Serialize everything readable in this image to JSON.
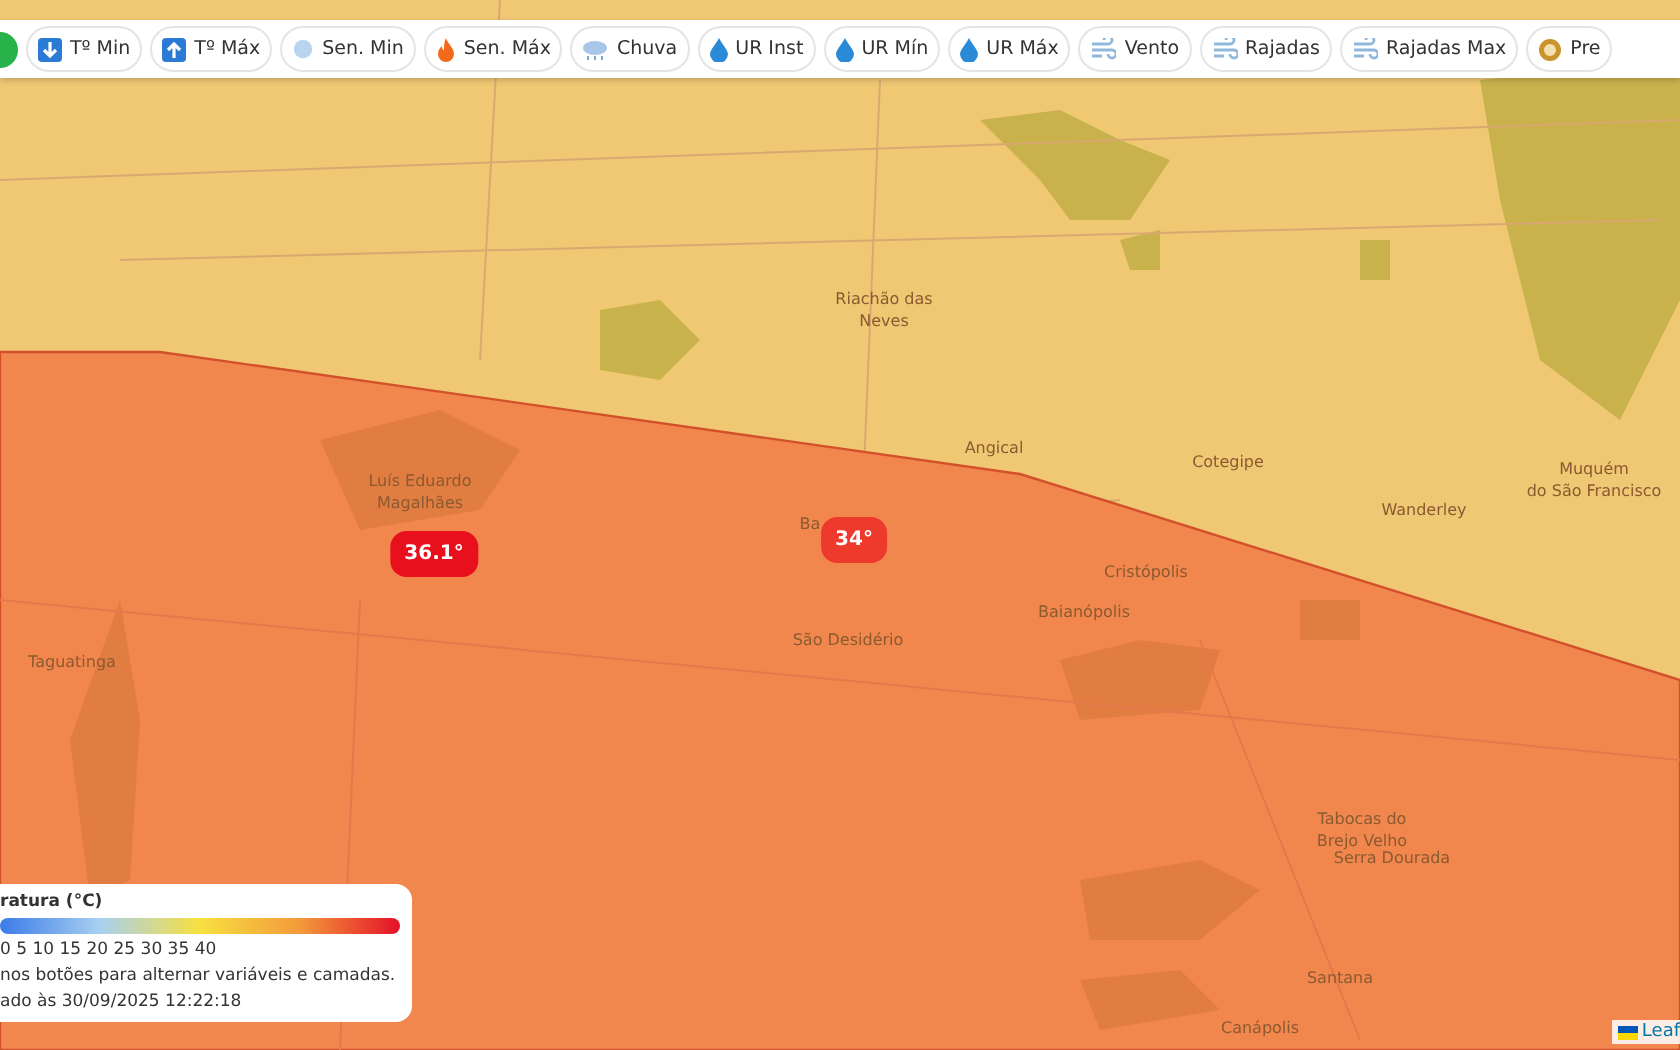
{
  "toolbar": {
    "buttons": [
      {
        "label": "Tº Min"
      },
      {
        "label": "Tº Máx"
      },
      {
        "label": "Sen. Min"
      },
      {
        "label": "Sen. Máx"
      },
      {
        "label": "Chuva"
      },
      {
        "label": "UR Inst"
      },
      {
        "label": "UR Mín"
      },
      {
        "label": "UR Máx"
      },
      {
        "label": "Vento"
      },
      {
        "label": "Rajadas"
      },
      {
        "label": "Rajadas Max"
      },
      {
        "label": "Pre"
      }
    ]
  },
  "map": {
    "places": [
      {
        "name": "Riachão das\nNeves"
      },
      {
        "name": "Angical"
      },
      {
        "name": "Cotegipe"
      },
      {
        "name": "Wanderley"
      },
      {
        "name": "Muquém\ndo São Francisco"
      },
      {
        "name": "Luís Eduardo\nMagalhães"
      },
      {
        "name": "Ba"
      },
      {
        "name": "Cristópolis"
      },
      {
        "name": "Baianópolis"
      },
      {
        "name": "São Desidério"
      },
      {
        "name": "Taguatinga"
      },
      {
        "name": "Tabocas do\nBrejo Velho"
      },
      {
        "name": "Serra Dourada"
      },
      {
        "name": "Santana"
      },
      {
        "name": "Canápolis"
      }
    ],
    "markers": [
      {
        "value": "36.1°",
        "color": "#e8101c"
      },
      {
        "value": "34°",
        "color": "#ee3a2c"
      }
    ]
  },
  "legend": {
    "title": "ratura (°C)",
    "scale": "0 5 10 15 20 25 30 35 40",
    "hint": "nos botões para alternar variáveis e camadas.",
    "updated": "ado às 30/09/2025 12:22:18"
  },
  "attribution": "Leaf"
}
